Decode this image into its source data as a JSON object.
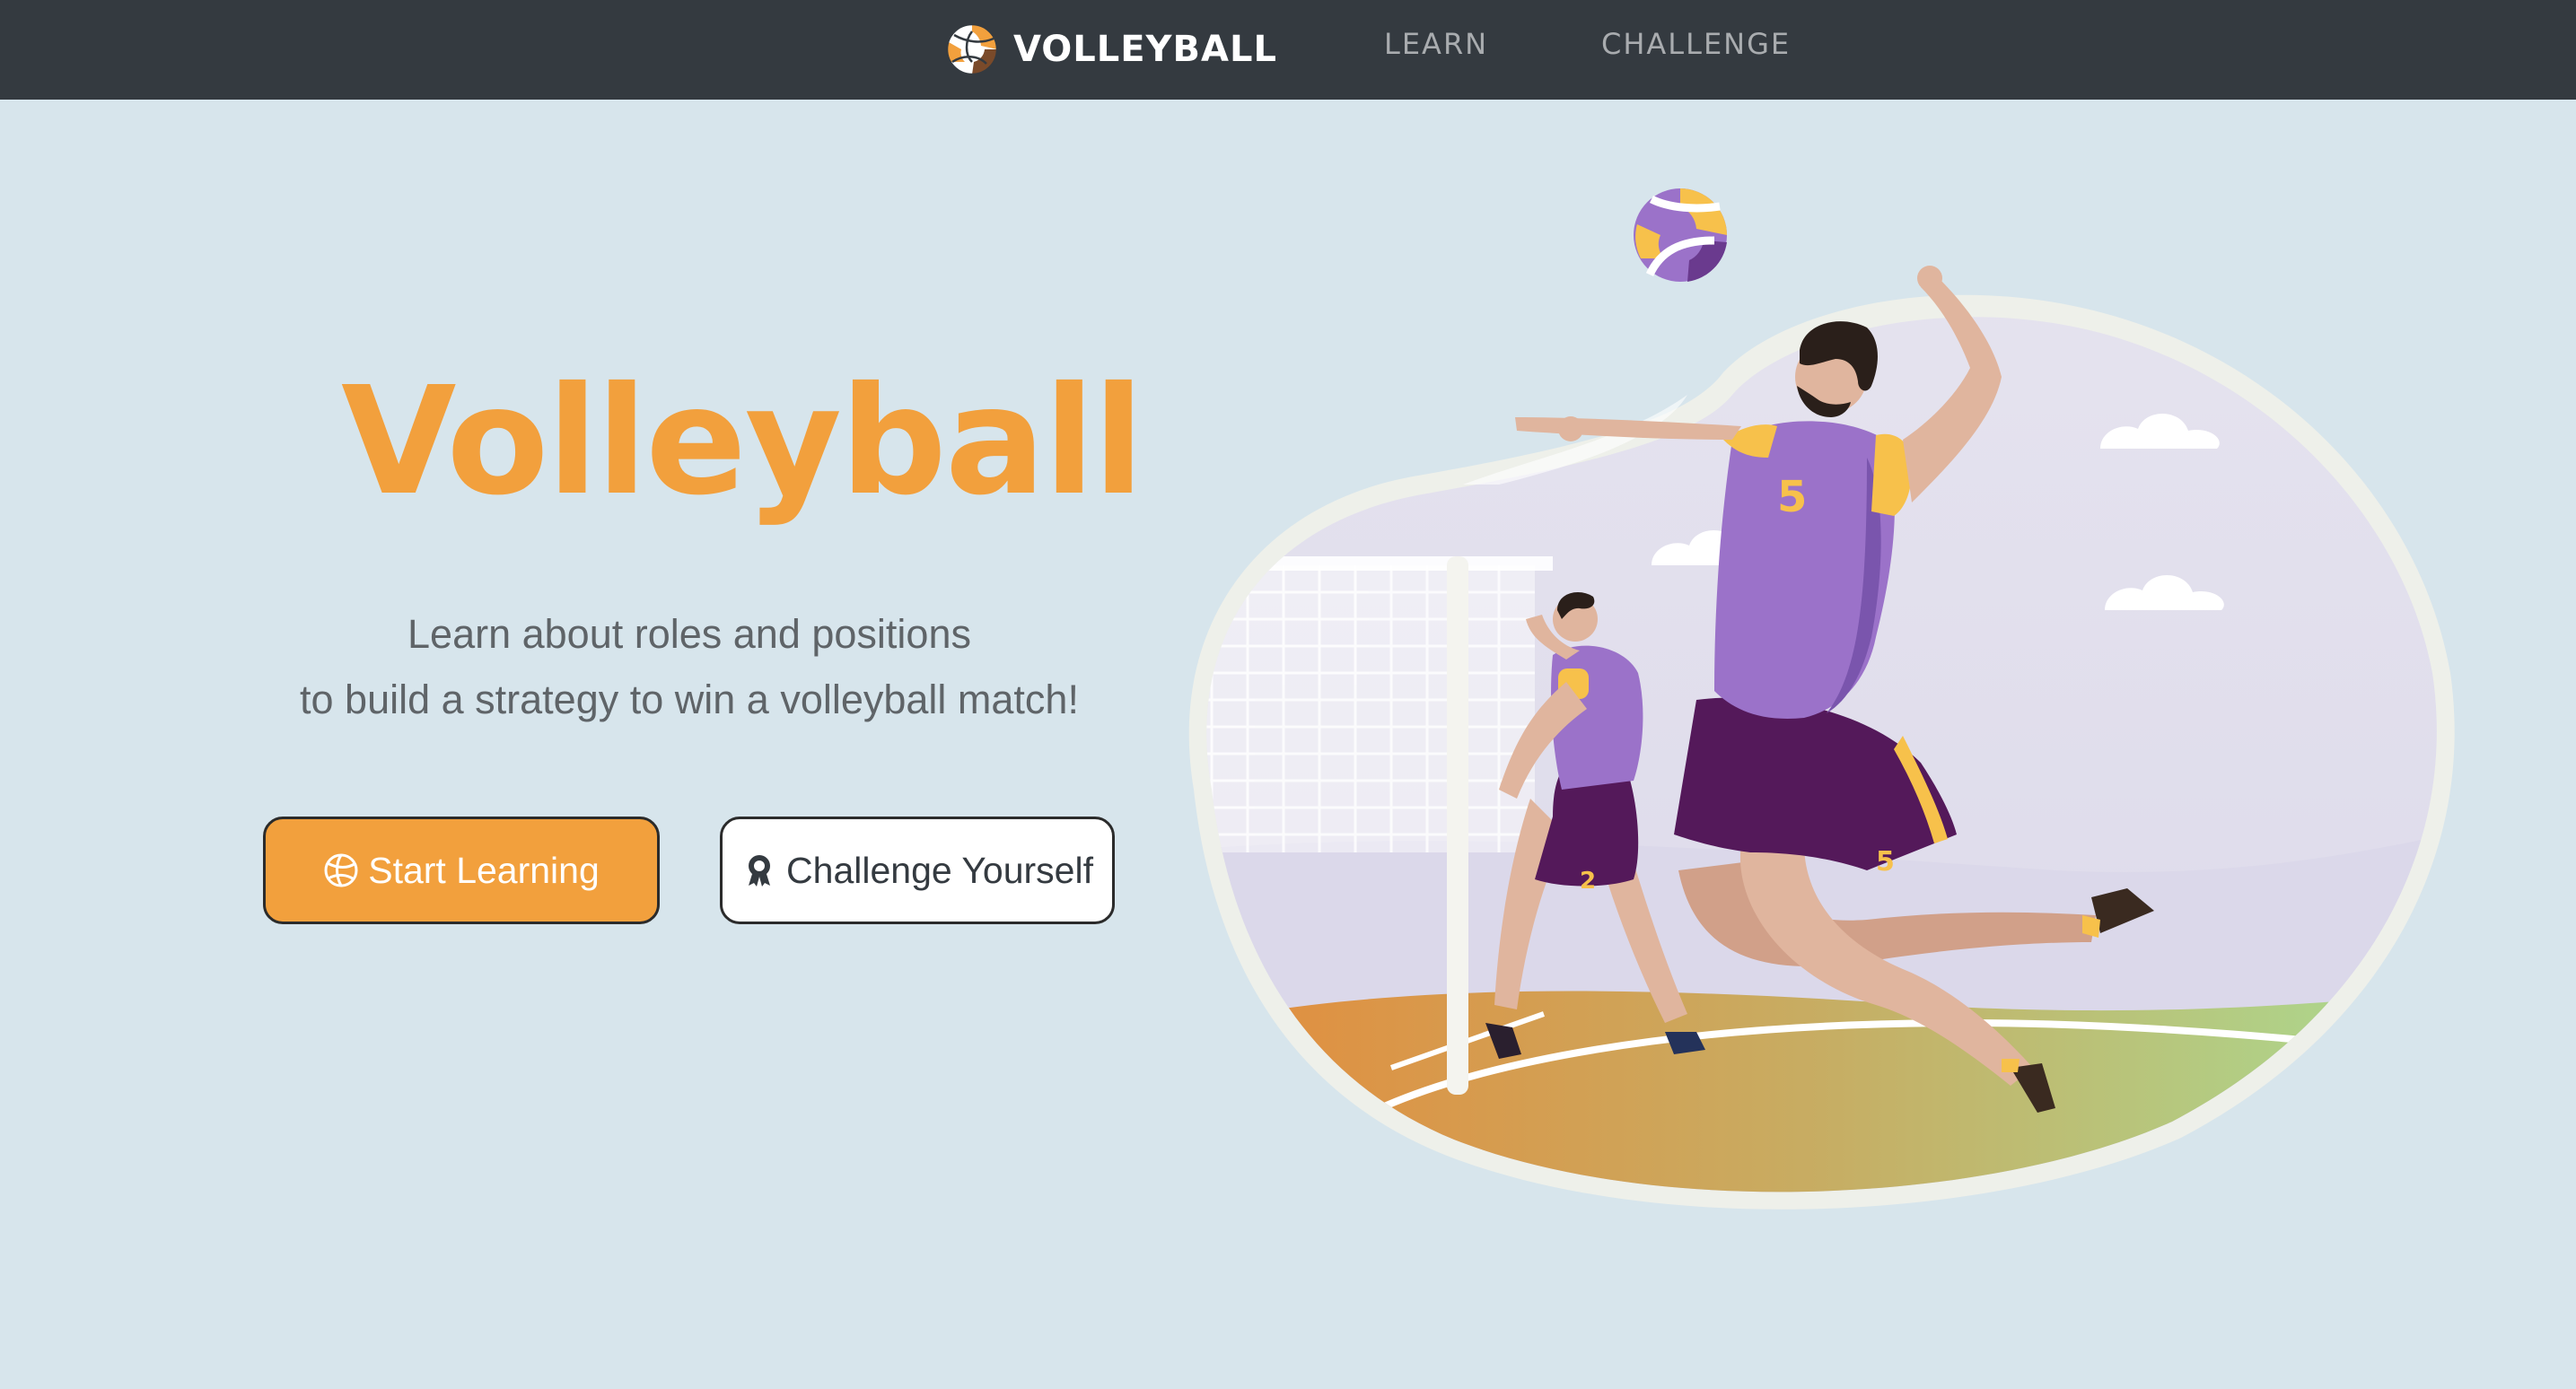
{
  "navbar": {
    "brand": "VOLLEYBALL",
    "links": [
      "LEARN",
      "CHALLENGE"
    ]
  },
  "hero": {
    "title": "Volleyball",
    "subtitle_line1": "Learn about roles and positions",
    "subtitle_line2": "to build a strategy to win a volleyball match!",
    "buttons": {
      "start_learning": "Start Learning",
      "challenge_yourself": "Challenge Yourself"
    }
  },
  "illustration": {
    "player_front_number": "5",
    "player_back_number": "2"
  },
  "colors": {
    "navbar_bg": "#343a40",
    "page_bg": "#d7e5ec",
    "accent_orange": "#f2a03d",
    "jersey_purple": "#9b72c9",
    "shorts_purple": "#54195a"
  },
  "icons": [
    "volleyball-icon",
    "award-icon"
  ]
}
